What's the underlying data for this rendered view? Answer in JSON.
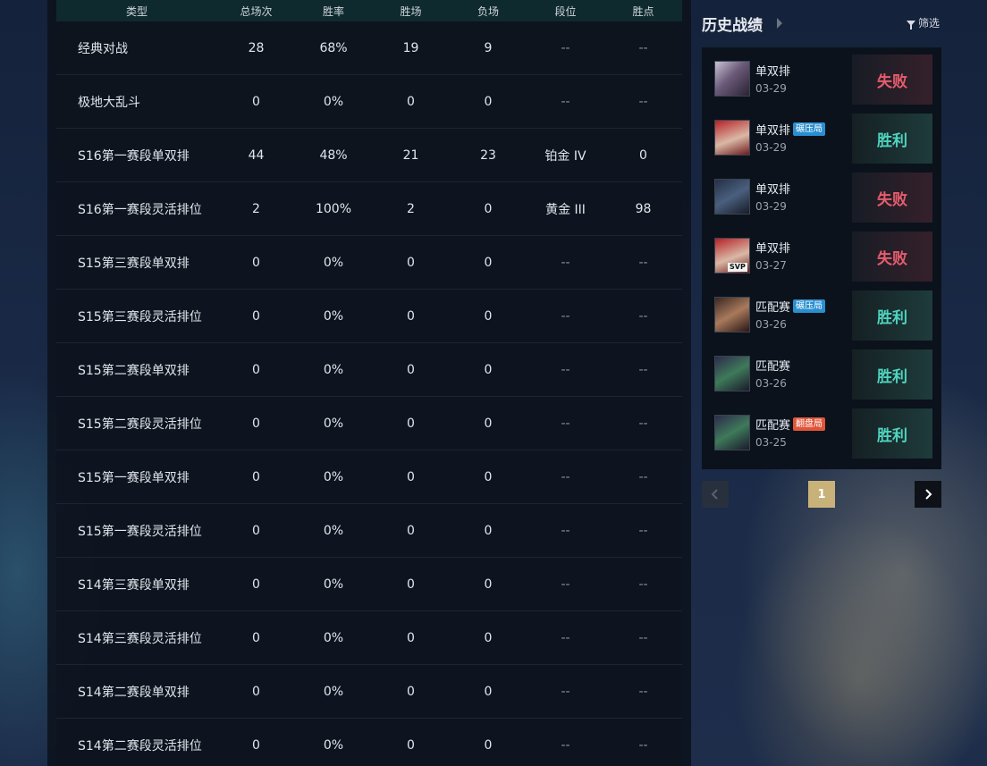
{
  "table": {
    "headers": [
      "类型",
      "总场次",
      "胜率",
      "胜场",
      "负场",
      "段位",
      "胜点"
    ],
    "rows": [
      [
        "经典对战",
        "28",
        "68%",
        "19",
        "9",
        "--",
        "--"
      ],
      [
        "极地大乱斗",
        "0",
        "0%",
        "0",
        "0",
        "--",
        "--"
      ],
      [
        "S16第一赛段单双排",
        "44",
        "48%",
        "21",
        "23",
        "铂金 IV",
        "0"
      ],
      [
        "S16第一赛段灵活排位",
        "2",
        "100%",
        "2",
        "0",
        "黄金 III",
        "98"
      ],
      [
        "S15第三赛段单双排",
        "0",
        "0%",
        "0",
        "0",
        "--",
        "--"
      ],
      [
        "S15第三赛段灵活排位",
        "0",
        "0%",
        "0",
        "0",
        "--",
        "--"
      ],
      [
        "S15第二赛段单双排",
        "0",
        "0%",
        "0",
        "0",
        "--",
        "--"
      ],
      [
        "S15第二赛段灵活排位",
        "0",
        "0%",
        "0",
        "0",
        "--",
        "--"
      ],
      [
        "S15第一赛段单双排",
        "0",
        "0%",
        "0",
        "0",
        "--",
        "--"
      ],
      [
        "S15第一赛段灵活排位",
        "0",
        "0%",
        "0",
        "0",
        "--",
        "--"
      ],
      [
        "S14第三赛段单双排",
        "0",
        "0%",
        "0",
        "0",
        "--",
        "--"
      ],
      [
        "S14第三赛段灵活排位",
        "0",
        "0%",
        "0",
        "0",
        "--",
        "--"
      ],
      [
        "S14第二赛段单双排",
        "0",
        "0%",
        "0",
        "0",
        "--",
        "--"
      ],
      [
        "S14第二赛段灵活排位",
        "0",
        "0%",
        "0",
        "0",
        "--",
        "--"
      ]
    ]
  },
  "history": {
    "title": "历史战绩",
    "filter_label": "筛选",
    "matches": [
      {
        "mode": "单双排",
        "tag": "",
        "tag_color": "",
        "date": "03-29",
        "result": "失败",
        "outcome": "lose",
        "avatar": "champion-portrait-white-hair",
        "svp": ""
      },
      {
        "mode": "单双排",
        "tag": "碾压局",
        "tag_color": "blue",
        "date": "03-29",
        "result": "胜利",
        "outcome": "win",
        "avatar": "champion-portrait-red-hair",
        "svp": ""
      },
      {
        "mode": "单双排",
        "tag": "",
        "tag_color": "",
        "date": "03-29",
        "result": "失败",
        "outcome": "lose",
        "avatar": "champion-portrait-dark",
        "svp": ""
      },
      {
        "mode": "单双排",
        "tag": "",
        "tag_color": "",
        "date": "03-27",
        "result": "失败",
        "outcome": "lose",
        "avatar": "champion-portrait-red-hair",
        "svp": "SVP"
      },
      {
        "mode": "匹配赛",
        "tag": "碾压局",
        "tag_color": "blue",
        "date": "03-26",
        "result": "胜利",
        "outcome": "win",
        "avatar": "champion-portrait-bald",
        "svp": ""
      },
      {
        "mode": "匹配赛",
        "tag": "",
        "tag_color": "",
        "date": "03-26",
        "result": "胜利",
        "outcome": "win",
        "avatar": "champion-portrait-masked",
        "svp": ""
      },
      {
        "mode": "匹配赛",
        "tag": "翻盘局",
        "tag_color": "red",
        "date": "03-25",
        "result": "胜利",
        "outcome": "win",
        "avatar": "champion-portrait-masked",
        "svp": ""
      }
    ]
  },
  "pager": {
    "current": "1"
  },
  "colors": {
    "win": "#4fd4bf",
    "lose": "#e55d6e",
    "page_active": "#c9b27a"
  }
}
